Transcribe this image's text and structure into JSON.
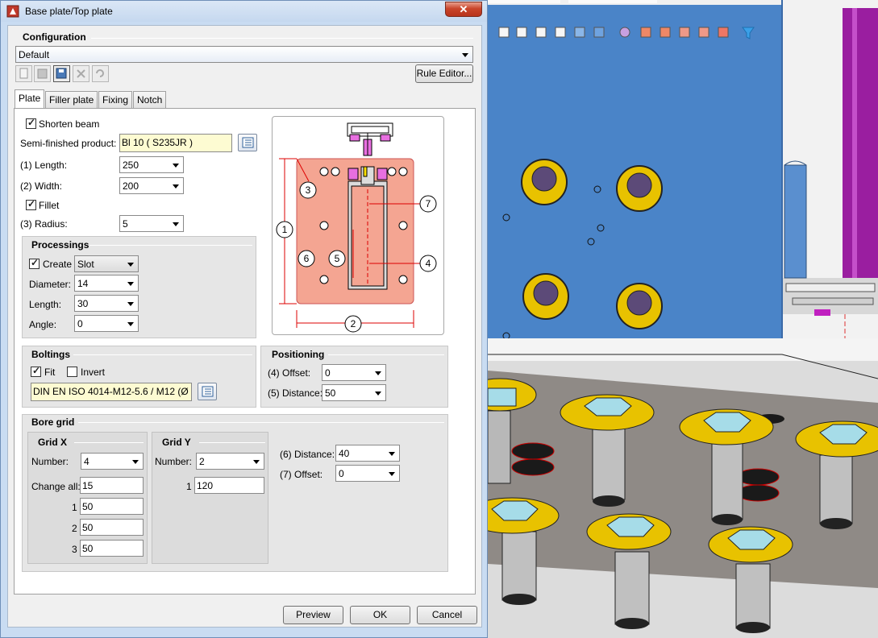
{
  "window": {
    "title": "Base plate/Top plate",
    "close_glyph": "✕"
  },
  "configuration": {
    "section_label": "Configuration",
    "selected": "Default",
    "rule_editor_label": "Rule Editor..."
  },
  "tabs": [
    {
      "label": "Plate",
      "active": true
    },
    {
      "label": "Filler plate",
      "active": false
    },
    {
      "label": "Fixing",
      "active": false
    },
    {
      "label": "Notch",
      "active": false
    }
  ],
  "plate": {
    "shorten_beam_label": "Shorten beam",
    "shorten_beam_checked": true,
    "semi_finished_label": "Semi-finished product:",
    "semi_finished_value": "Bl 10  ( S235JR )",
    "length_label": "(1) Length:",
    "length_value": "250",
    "width_label": "(2) Width:",
    "width_value": "200",
    "fillet_label": "Fillet",
    "fillet_checked": true,
    "radius_label": "(3) Radius:",
    "radius_value": "5"
  },
  "processings": {
    "section_label": "Processings",
    "create_label": "Create",
    "create_checked": true,
    "create_type": "Slot",
    "diameter_label": "Diameter:",
    "diameter_value": "14",
    "length_label": "Length:",
    "length_value": "30",
    "angle_label": "Angle:",
    "angle_value": "0"
  },
  "boltings": {
    "section_label": "Boltings",
    "fit_label": "Fit",
    "fit_checked": true,
    "invert_label": "Invert",
    "invert_checked": false,
    "bolt_value": "DIN EN ISO 4014-M12-5.6 / M12 (Ø"
  },
  "positioning": {
    "section_label": "Positioning",
    "offset_label": "(4) Offset:",
    "offset_value": "0",
    "distance_label": "(5) Distance:",
    "distance_value": "50"
  },
  "bore_grid": {
    "section_label": "Bore grid",
    "grid_x": {
      "label": "Grid X",
      "number_label": "Number:",
      "number_value": "4",
      "change_all_label": "Change all:",
      "change_all_value": "15",
      "rows": [
        {
          "index": "1",
          "value": "50"
        },
        {
          "index": "2",
          "value": "50"
        },
        {
          "index": "3",
          "value": "50"
        }
      ]
    },
    "grid_y": {
      "label": "Grid Y",
      "number_label": "Number:",
      "number_value": "2",
      "rows": [
        {
          "index": "1",
          "value": "120"
        }
      ]
    },
    "distance_label": "(6) Distance:",
    "distance_value": "40",
    "offset_label": "(7) Offset:",
    "offset_value": "0"
  },
  "diagram": {
    "callouts": [
      "1",
      "2",
      "3",
      "4",
      "5",
      "6",
      "7"
    ]
  },
  "buttons": {
    "preview": "Preview",
    "ok": "OK",
    "cancel": "Cancel"
  },
  "colors": {
    "plate_fill": "#f4a592",
    "beam_fill": "#dcdcdc",
    "pink_block": "#e86fe0",
    "title_icon": "#c0392b",
    "wall_blue": "#4a84c8",
    "washer_gold": "#e8c200",
    "nut_cyan": "#a6dce8",
    "purple_rail": "#9a1ea0"
  }
}
